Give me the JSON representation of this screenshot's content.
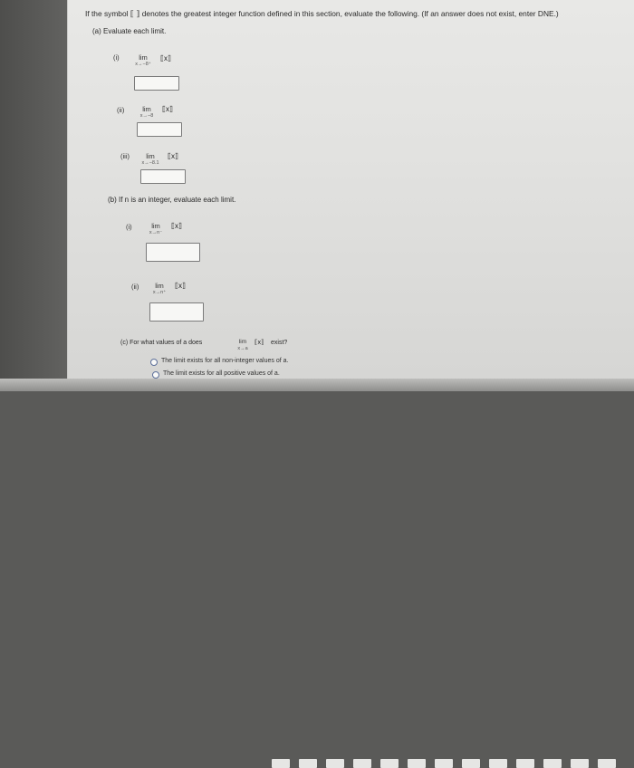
{
  "question": {
    "text": "If the symbol ⟦ ⟧ denotes the greatest integer function defined in this section, evaluate the following. (If an answer does not exist, enter DNE.)"
  },
  "part_a": {
    "label": "(a)  Evaluate each limit.",
    "items": [
      {
        "num": "(i)",
        "lim": "lim",
        "approach": "x→−8⁺",
        "expr": "⟦x⟧",
        "answer": ""
      },
      {
        "num": "(ii)",
        "lim": "lim",
        "approach": "x→−8",
        "expr": "⟦x⟧",
        "answer": ""
      },
      {
        "num": "(iii)",
        "lim": "lim",
        "approach": "x→−8.1",
        "expr": "⟦x⟧",
        "answer": ""
      }
    ]
  },
  "part_b": {
    "label": "(b)  If n is an integer, evaluate each limit.",
    "items": [
      {
        "num": "(i)",
        "lim": "lim",
        "approach": "x→n⁻",
        "expr": "⟦x⟧",
        "answer": ""
      },
      {
        "num": "(ii)",
        "lim": "lim",
        "approach": "x→n⁺",
        "expr": "⟦x⟧",
        "answer": ""
      }
    ]
  },
  "part_c": {
    "label_start": "(c)  For what values of a does",
    "lim": "lim",
    "approach": "x→a",
    "expr": "⟦x⟧",
    "label_end": "exist?",
    "options": [
      "The limit exists for all non-integer values of a.",
      "The limit exists for all positive values of a."
    ]
  }
}
